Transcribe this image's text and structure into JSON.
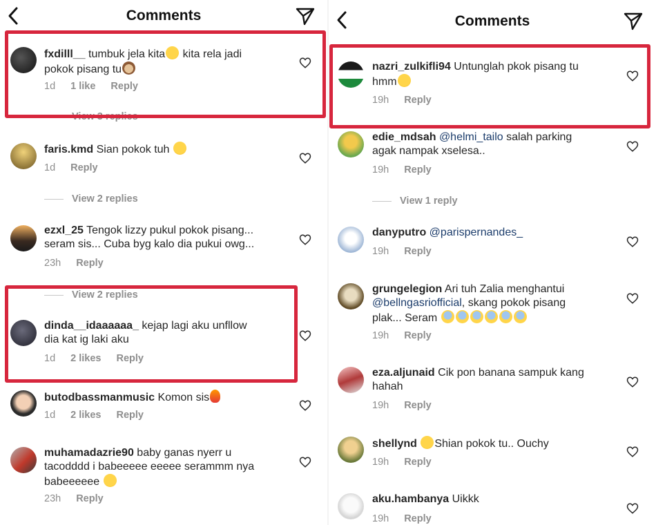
{
  "left": {
    "title": "Comments",
    "hidden_replies_1": "View 3 replies",
    "comments": [
      {
        "user": "fxdilll__",
        "text": "tumbuk jela kita",
        "text2": "kita rela jadi",
        "line2": "pokok pisang tu",
        "time": "1d",
        "likes": "1 like",
        "reply": "Reply"
      },
      {
        "user": "faris.kmd",
        "text": "Sian pokok tuh",
        "time": "1d",
        "reply": "Reply"
      },
      {
        "view_replies": "View 2 replies"
      },
      {
        "user": "ezxl_25",
        "text": "Tengok lizzy pukul pokok pisang...",
        "line2": "seram sis... Cuba byg kalo dia pukui owg...",
        "time": "23h",
        "reply": "Reply"
      },
      {
        "view_replies": "View 2 replies"
      },
      {
        "user": "dinda__idaaaaaa_",
        "text": "kejap lagi aku unfllow",
        "line2": "dia kat ig laki aku",
        "time": "1d",
        "likes": "2 likes",
        "reply": "Reply"
      },
      {
        "user": "butodbassmanmusic",
        "text": "Komon sis",
        "time": "1d",
        "likes": "2 likes",
        "reply": "Reply"
      },
      {
        "user": "muhamadazrie90",
        "text": "baby ganas nyerr u",
        "line2": "tacodddd i babeeeee eeeee serammm nya",
        "line3": "babeeeeee",
        "time": "23h",
        "reply": "Reply"
      }
    ]
  },
  "right": {
    "title": "Comments",
    "comments": [
      {
        "user": "nazri_zulkifli94",
        "text": "Untunglah pkok pisang tu",
        "line2": "hmm",
        "time": "19h",
        "reply": "Reply"
      },
      {
        "user": "edie_mdsah",
        "mention": "@helmi_tailo",
        "text": "salah parking",
        "line2": "agak nampak xselesa..",
        "time": "19h",
        "reply": "Reply"
      },
      {
        "view_replies": "View 1 reply"
      },
      {
        "user": "danyputro",
        "mention": "@parispernandes_",
        "time": "19h",
        "reply": "Reply"
      },
      {
        "user": "grungelegion",
        "text": "Ari tuh Zalia menghantui",
        "mention": "@bellngasriofficial",
        "text2": ", skang pokok pisang",
        "line3": "plak... Seram",
        "time": "19h",
        "reply": "Reply"
      },
      {
        "user": "eza.aljunaid",
        "text": "Cik pon banana sampuk kang",
        "line2": "hahah",
        "time": "19h",
        "reply": "Reply"
      },
      {
        "user": "shellynd",
        "text": "Shian pokok tu.. Ouchy",
        "time": "19h",
        "reply": "Reply"
      },
      {
        "user": "aku.hambanya",
        "text": "Uikkk",
        "time": "19h",
        "reply": "Reply"
      }
    ]
  },
  "colors": {
    "highlight": "#d7263d",
    "meta": "#8e8e8e",
    "mention": "#1b3c6b"
  }
}
